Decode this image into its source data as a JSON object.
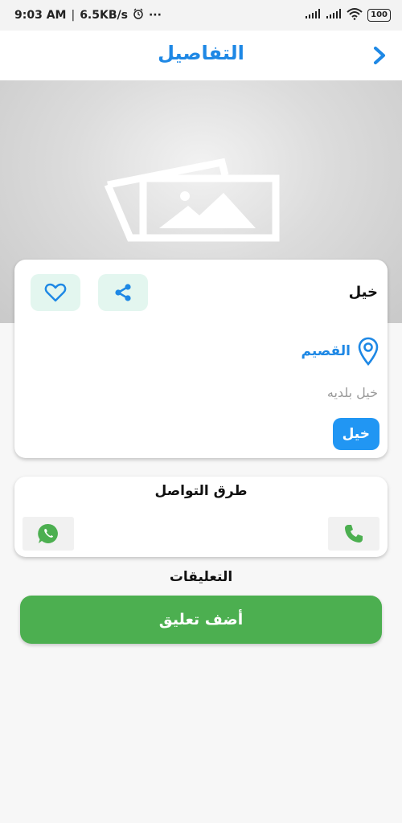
{
  "status_bar": {
    "time": "9:03 AM",
    "speed": "6.5KB/s",
    "dots": "···",
    "battery": "100"
  },
  "header": {
    "title": "التفاصيل"
  },
  "item": {
    "title": "خيل",
    "location": "القصيم",
    "municipality": "خيل بلديه",
    "category": "خيل"
  },
  "contact": {
    "title": "طرق التواصل"
  },
  "comments": {
    "title": "التعليقات",
    "add_button": "أضف تعليق"
  },
  "colors": {
    "accent_blue": "#1e88e5",
    "chip_blue": "#2196f3",
    "green": "#4caf50",
    "action_tint": "#e3f6ef"
  }
}
